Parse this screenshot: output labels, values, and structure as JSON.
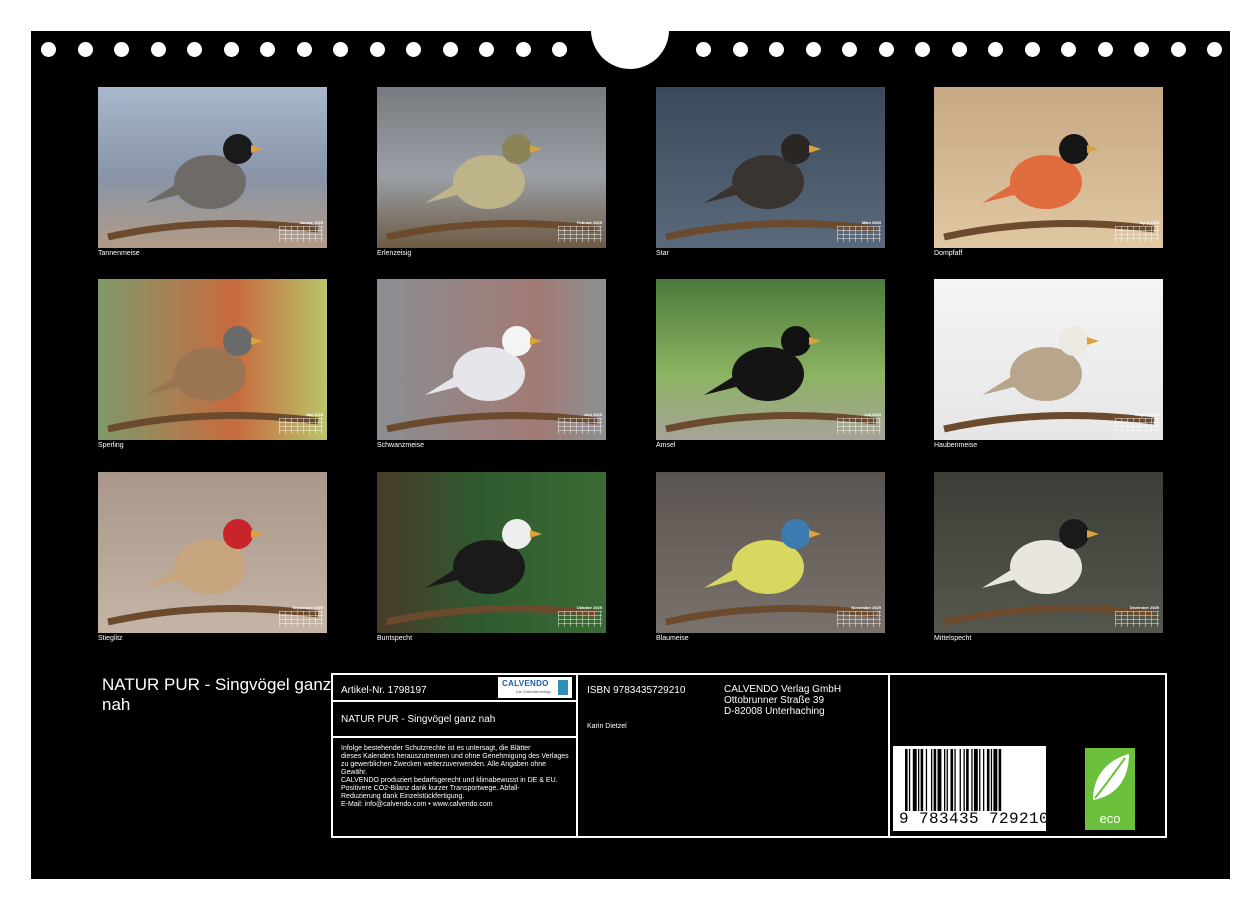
{
  "tiles": [
    {
      "caption": "Tannenmeise",
      "month": "Januar 2025",
      "bg": "linear-gradient(180deg,#a9b8cc 0%,#8894a8 55%,#b19b86 100%)",
      "body": "#6e6a66",
      "head": "#1a1a1a"
    },
    {
      "caption": "Erlenzeisig",
      "month": "Februar 2025",
      "bg": "linear-gradient(180deg,#777b80 0%,#9aa0a6 55%,#6d5a44 100%)",
      "body": "#bdb48a",
      "head": "#8a8458"
    },
    {
      "caption": "Star",
      "month": "März 2025",
      "bg": "linear-gradient(180deg,#3a4a5c 0%,#5a6a7a 100%)",
      "body": "#3a3430",
      "head": "#2a2624"
    },
    {
      "caption": "Dompfaff",
      "month": "April 2025",
      "bg": "linear-gradient(180deg,#c7a883 0%,#e0c8a3 100%)",
      "body": "#e06b3d",
      "head": "#161616"
    },
    {
      "caption": "Sperling",
      "month": "Mai 2025",
      "bg": "linear-gradient(90deg,#7f9a6a 0%,#c86a3e 60%,#b9c46a 100%)",
      "body": "#9b7453",
      "head": "#6a6a6a"
    },
    {
      "caption": "Schwanzmeise",
      "month": "Juni 2025",
      "bg": "linear-gradient(90deg,#8a8f94 0%,#a27a74 70%,#8d9094 100%)",
      "body": "#e6e6ea",
      "head": "#f4f4f4"
    },
    {
      "caption": "Amsel",
      "month": "Juli 2025",
      "bg": "linear-gradient(180deg,#4d7a3a 0%,#8cb462 60%,#a8a29a 100%)",
      "body": "#141414",
      "head": "#111111"
    },
    {
      "caption": "Haubenmeise",
      "month": "August 2025",
      "bg": "linear-gradient(180deg,#f4f4f4 0%,#e6e6e6 100%)",
      "body": "#b7a68c",
      "head": "#ece9e3"
    },
    {
      "caption": "Stieglitz",
      "month": "September 2025",
      "bg": "linear-gradient(180deg,#a8978a 0%,#c4b5a6 100%)",
      "body": "#c7a57f",
      "head": "#c8242a"
    },
    {
      "caption": "Buntspecht",
      "month": "Oktober 2025",
      "bg": "linear-gradient(90deg,#4a3a2a 0%,#2f5a2f 45%,#3b6b34 100%)",
      "body": "#1a1a1a",
      "head": "#eeeeee"
    },
    {
      "caption": "Blaumeise",
      "month": "November 2025",
      "bg": "linear-gradient(180deg,#5a5450 0%,#7a726c 100%)",
      "body": "#d8d860",
      "head": "#3c7ab0"
    },
    {
      "caption": "Mittelspecht",
      "month": "Dezember 2025",
      "bg": "linear-gradient(180deg,#3a3e36 0%,#55584e 100%)",
      "body": "#e9e6e0",
      "head": "#1a1a1a"
    }
  ],
  "calendar_title": "NATUR PUR - Singvögel ganz nah",
  "info": {
    "article": "Artikel-Nr. 1798197",
    "logo_text": "CALVENDO",
    "logo_sub": "Der Kalenderverlag",
    "title_repeat": "NATUR PUR - Singvögel ganz nah",
    "legal": [
      "Infolge bestehender Schutzrechte ist es untersagt, die Blätter",
      "dieses Kalenders herauszutrennen und ohne Genehmigung des Verlages",
      "zu gewerblichen Zwecken weiterzuverwenden. Alle Angaben ohne",
      "Gewähr.",
      "CALVENDO produziert bedarfsgerecht und klimabewusst in DE & EU.",
      "Positivere CO2-Bilanz dank kurzer Transportwege. Abfall-",
      "Reduzierung dank Einzelstückfertigung.",
      "E-Mail: info@calvendo.com • www.calvendo.com"
    ],
    "isbn": "ISBN 9783435729210",
    "author": "Karin Dietzel",
    "publisher": [
      "CALVENDO Verlag GmbH",
      "Ottobrunner Straße 39",
      "D-82008 Unterhaching"
    ],
    "barcode_number": "9 783435 729210",
    "eco_label": "eco"
  },
  "colors": {
    "background": "#000000",
    "text": "#ffffff",
    "eco_green": "#6bbf3b"
  }
}
